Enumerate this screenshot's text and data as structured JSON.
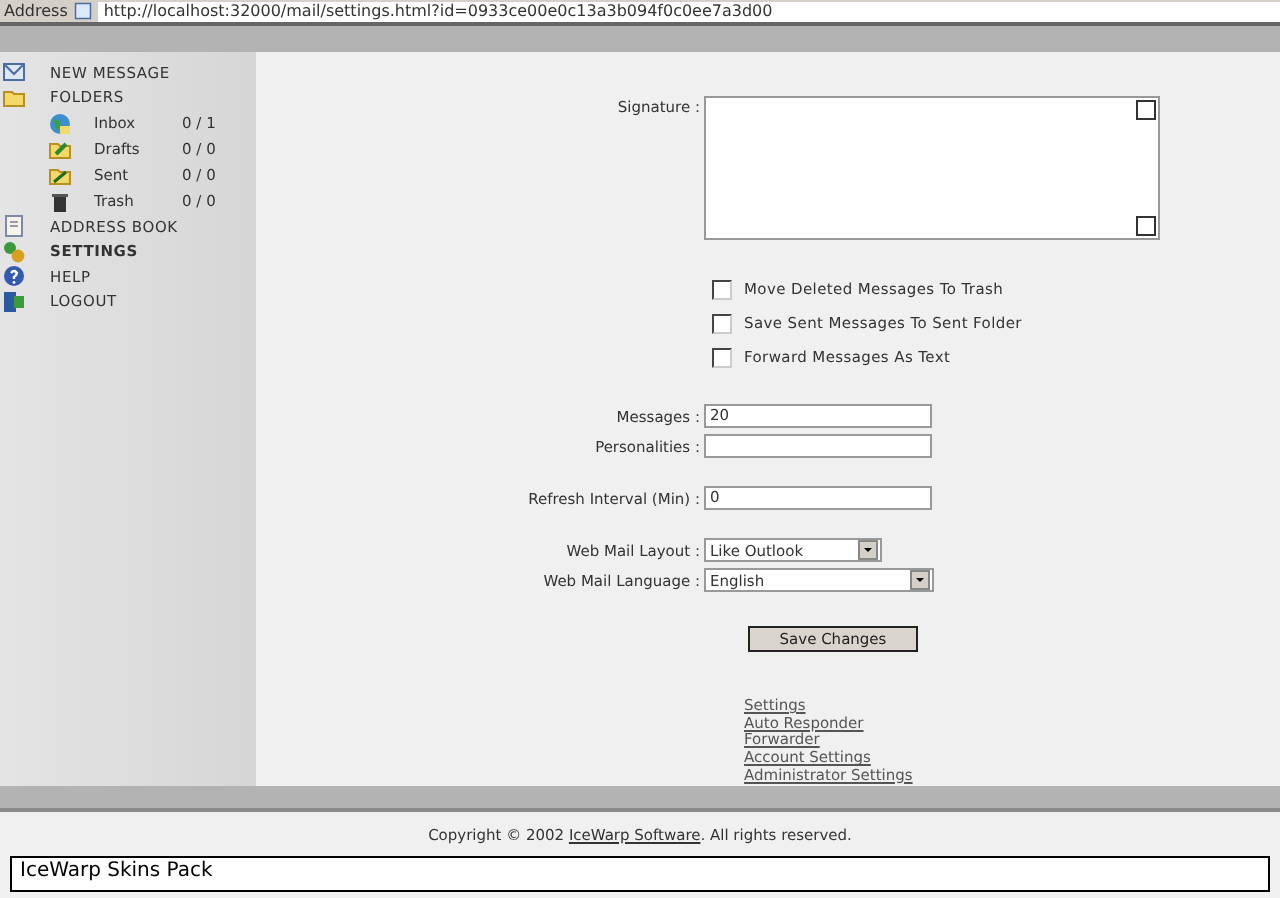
{
  "address_bar": {
    "label": "Address",
    "url": "http://localhost:32000/mail/settings.html?id=0933ce00e0c13a3b094f0c0ee7a3d00"
  },
  "sidebar": {
    "items": [
      {
        "kind": "new",
        "label": "NEW MESSAGE",
        "selected": false
      },
      {
        "kind": "folders",
        "label": "FOLDERS",
        "selected": false,
        "children": [
          {
            "kind": "inbox",
            "label": "Inbox",
            "count": "0 / 1"
          },
          {
            "kind": "drafts",
            "label": "Drafts",
            "count": "0 / 0"
          },
          {
            "kind": "sent",
            "label": "Sent",
            "count": "0 / 0"
          },
          {
            "kind": "trash",
            "label": "Trash",
            "count": "0 / 0"
          }
        ]
      },
      {
        "kind": "book",
        "label": "ADDRESS BOOK",
        "selected": false
      },
      {
        "kind": "settings",
        "label": "SETTINGS",
        "selected": true
      },
      {
        "kind": "help",
        "label": "HELP",
        "selected": false
      },
      {
        "kind": "logout",
        "label": "LOGOUT",
        "selected": false
      }
    ]
  },
  "form": {
    "signature": {
      "label": "Signature :"
    },
    "checkboxes": [
      {
        "label": "Move Deleted Messages To Trash",
        "checked": false
      },
      {
        "label": "Save Sent Messages To Sent Folder",
        "checked": false
      },
      {
        "label": "Forward Messages As Text",
        "checked": false
      }
    ],
    "fields": [
      {
        "label": "Messages :",
        "value": "20"
      },
      {
        "label": "Personalities :"
      },
      {
        "label": "Refresh Interval (Min) :",
        "value": "0"
      }
    ],
    "selects": [
      {
        "label": "Web Mail Layout :",
        "value": "Like Outlook"
      },
      {
        "label": "Web Mail Language :",
        "value": "English"
      }
    ],
    "save_button": "Save Changes",
    "links": [
      "Settings",
      "Auto Responder",
      "Forwarder",
      "Account Settings",
      "Administrator Settings"
    ]
  },
  "footer": {
    "before": "Copyright © 2002",
    "link": "IceWarp Software",
    "after": ". All rights reserved."
  },
  "status": "IceWarp Skins Pack"
}
